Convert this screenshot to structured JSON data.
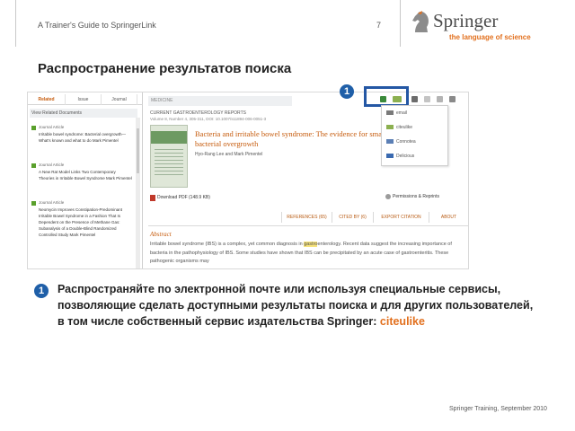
{
  "header": {
    "guide_title": "A Trainer's Guide to SpringerLink",
    "page_number": "7",
    "logo_word": "Springer",
    "logo_tagline": "the language of science"
  },
  "slide_title": "Распространение результатов поиска",
  "callout_number": "1",
  "screenshot": {
    "related_panel": {
      "tabs": [
        "Related",
        "Issue",
        "Journal"
      ],
      "heading": "View Related Documents",
      "results": [
        {
          "type": "Journal Article",
          "text": "Irritable bowel syndrome: Bacterial overgrowth—What's known and what to do Mark Pimentel"
        },
        {
          "type": "Journal Article",
          "text": "A New Rat Model Links Two Contemporary Theories in Irritable Bowel Syndrome Mark Pimentel"
        },
        {
          "type": "Journal Article",
          "text": "Neomycin Improves Constipation-Predominant Irritable Bowel Syndrome in a Fashion That Is Dependent on the Presence of Methane Gas: Subanalysis of a Double-Blind Randomized Controlled Study Mark Pimentel"
        }
      ]
    },
    "article": {
      "breadcrumb": "MEDICINE",
      "journal": "CURRENT GASTROENTEROLOGY REPORTS",
      "volume": "Volume 8, Number 4, 305-311, DOI: 10.1007/s11894-006-0051-3",
      "title": "Bacteria and irritable bowel syndrome: The evidence for small intestinal bacterial overgrowth",
      "authors": "Hyo-Rang Lee and Mark Pimentel",
      "pdf_link": "Download PDF (148.9 KB)",
      "permissions_link": "Permissions & Reprints",
      "tabs": [
        "REFERENCES (65)",
        "CITED BY (6)",
        "EXPORT CITATION",
        "ABOUT"
      ],
      "abstract_heading": "Abstract",
      "abstract_before": "Irritable bowel syndrome (IBS) is a complex, yet common diagnosis in ",
      "abstract_highlight": "gastro",
      "abstract_after": "enterology. Recent data suggest the increasing importance of bacteria in the pathophysiology of IBS. Some studies have shown that IBS can be precipitated by an acute case of gastroenteritis. These pathogenic organisms may"
    },
    "share_menu": [
      "email",
      "citeulike",
      "Connotea",
      "Delicious"
    ]
  },
  "description": {
    "text": "Распространяйте по электронной почте или используя специальные сервисы, позволяющие сделать доступными результаты поиска и для других пользователей, в том числе собственный сервис издательства Springer: ",
    "highlight": "citeulike"
  },
  "footer": "Springer Training, September 2010",
  "colors": {
    "accent": "#e2701e",
    "callout": "#2457a4",
    "badge": "#1f5fa8"
  }
}
